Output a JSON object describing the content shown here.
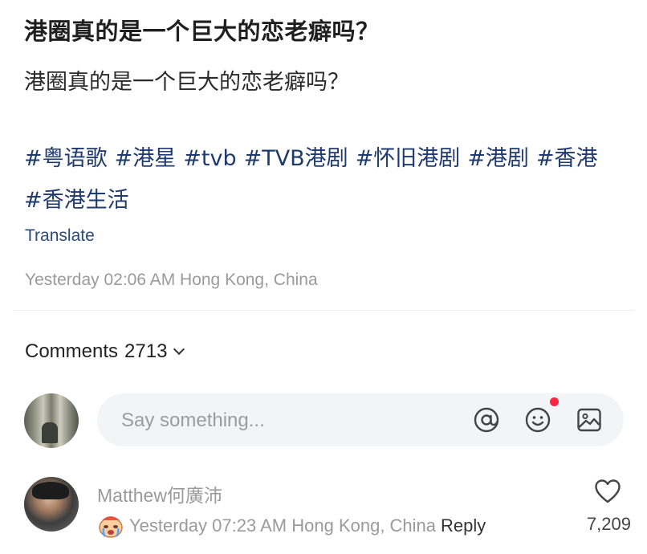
{
  "post": {
    "title": "港圈真的是一个巨大的恋老癖吗？",
    "body": "港圈真的是一个巨大的恋老癖吗？",
    "tags": [
      "#粤语歌",
      "#港星",
      "#tvb",
      "#TVB港剧",
      "#怀旧港剧",
      "#港剧",
      "#香港",
      "#香港生活"
    ],
    "translate_label": "Translate",
    "timestamp": "Yesterday 02:06 AM",
    "location": "Hong Kong, China"
  },
  "comments": {
    "header_label": "Comments",
    "count": "2713",
    "input_placeholder": "Say something...",
    "notification_color": "#ff2442",
    "items": [
      {
        "author": "Matthew何廣沛",
        "timestamp": "Yesterday 07:23 AM",
        "location": "Hong Kong, China",
        "reply_label": "Reply",
        "likes": "7,209"
      }
    ]
  },
  "icons": [
    "at-icon",
    "emoji-icon",
    "image-icon",
    "heart-icon",
    "chevron-down-icon",
    "crying-sticker-icon"
  ]
}
